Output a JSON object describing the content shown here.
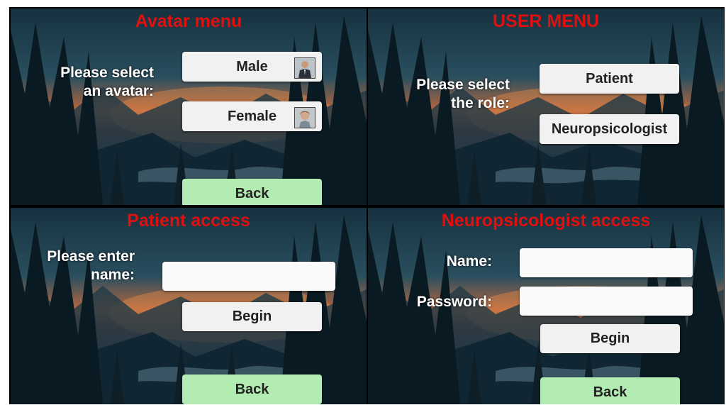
{
  "panels": {
    "avatar": {
      "title": "Avatar menu",
      "prompt_line1": "Please select",
      "prompt_line2": "an avatar:",
      "male_label": "Male",
      "female_label": "Female",
      "back_label": "Back",
      "male_icon": "male-avatar-icon",
      "female_icon": "female-avatar-icon"
    },
    "user": {
      "title": "USER MENU",
      "prompt_line1": "Please select",
      "prompt_line2": "the role:",
      "patient_label": "Patient",
      "neuro_label": "Neuropsicologist"
    },
    "patient": {
      "title": "Patient access",
      "prompt_line1": "Please enter",
      "prompt_line2": "name:",
      "name_value": "",
      "begin_label": "Begin",
      "back_label": "Back"
    },
    "neuro": {
      "title": "Neuropsicologist access",
      "name_label": "Name:",
      "password_label": "Password:",
      "name_value": "",
      "password_value": "",
      "begin_label": "Begin",
      "back_label": "Back"
    }
  },
  "colors": {
    "title": "#e01010",
    "button": "#f1f1f1",
    "back_button": "#b3ecb3"
  }
}
